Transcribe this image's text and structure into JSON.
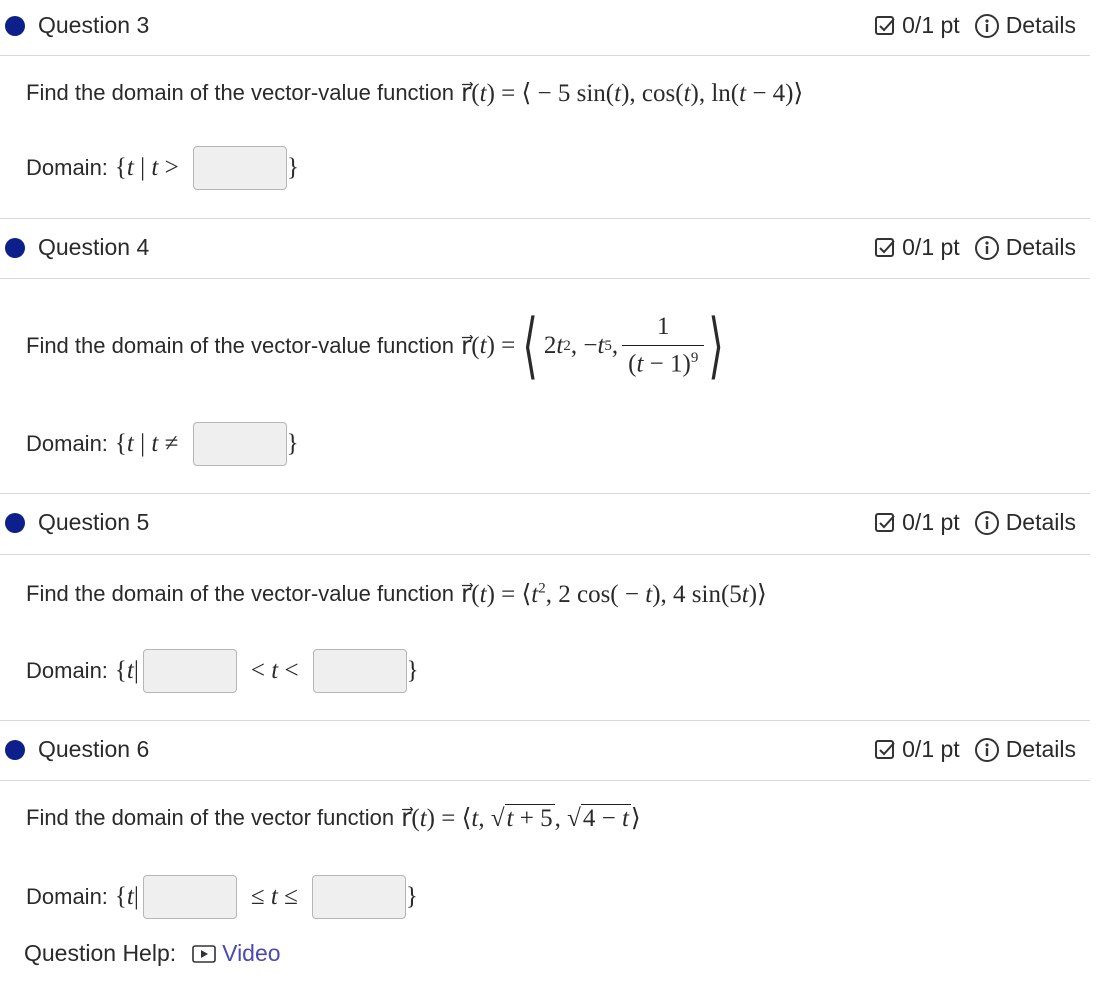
{
  "questions": [
    {
      "title": "Question 3",
      "points": "0/1 pt",
      "details": "Details",
      "prompt": "Find the domain of the vector-value function",
      "domain_label": "Domain:"
    },
    {
      "title": "Question 4",
      "points": "0/1 pt",
      "details": "Details",
      "prompt": "Find the domain of the vector-value function",
      "domain_label": "Domain:"
    },
    {
      "title": "Question 5",
      "points": "0/1 pt",
      "details": "Details",
      "prompt": "Find the domain of the vector-value function",
      "domain_label": "Domain:"
    },
    {
      "title": "Question 6",
      "points": "0/1 pt",
      "details": "Details",
      "prompt": "Find the domain of the vector function",
      "domain_label": "Domain:"
    }
  ],
  "help": {
    "label": "Question Help:",
    "video": "Video"
  },
  "colors": {
    "dot": "#0d1f8a",
    "link": "#4a4ab0"
  }
}
